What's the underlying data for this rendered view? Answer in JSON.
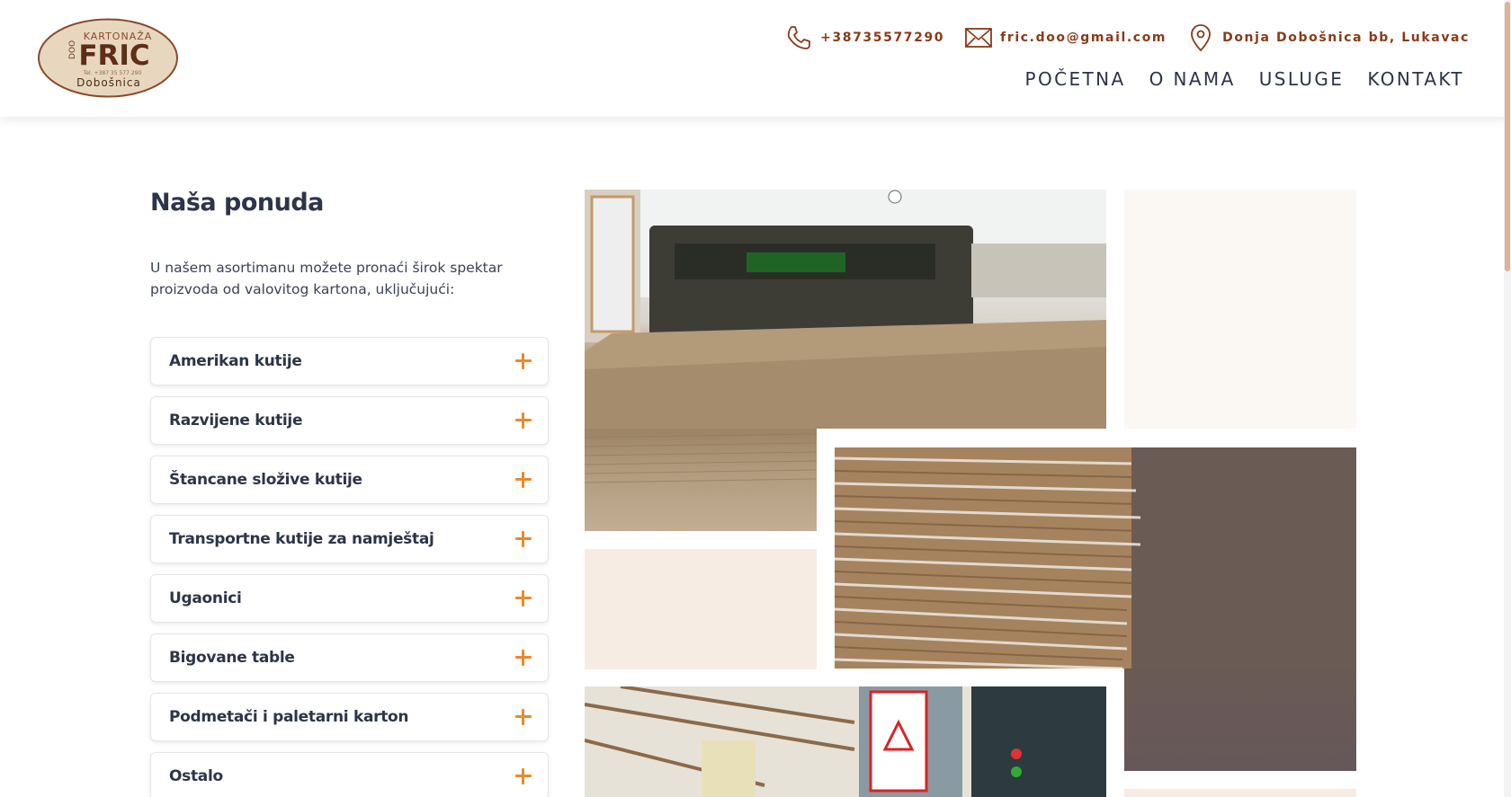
{
  "header": {
    "logo": {
      "top_text": "KARTONAŽA",
      "brand": "FRIC",
      "side_text": "DOO",
      "phone_line": "Tel. +387 35 577 290",
      "town": "Dobošnica"
    },
    "contact": {
      "phone": "+38735577290",
      "email": "fric.doo@gmail.com",
      "address": "Donja Dobošnica bb, Lukavac"
    },
    "nav": [
      "POČETNA",
      "O NAMA",
      "USLUGE",
      "KONTAKT"
    ]
  },
  "main": {
    "title": "Naša ponuda",
    "intro": "U našem asortimanu možete pronaći širok spektar proizvoda od valovitog kartona, uključujući:",
    "accordion": [
      "Amerikan kutije",
      "Razvijene kutije",
      "Štancane složive kutije",
      "Transportne kutije za namještaj",
      "Ugaonici",
      "Bigovane table",
      "Podmetači i paletarni karton",
      "Ostalo"
    ]
  },
  "colors": {
    "accent_orange": "#e98a2c",
    "contact_brown": "#8a3a18",
    "text_dark": "#2c3548"
  },
  "icons": [
    "phone-icon",
    "envelope-icon",
    "location-pin-icon",
    "plus-icon"
  ]
}
